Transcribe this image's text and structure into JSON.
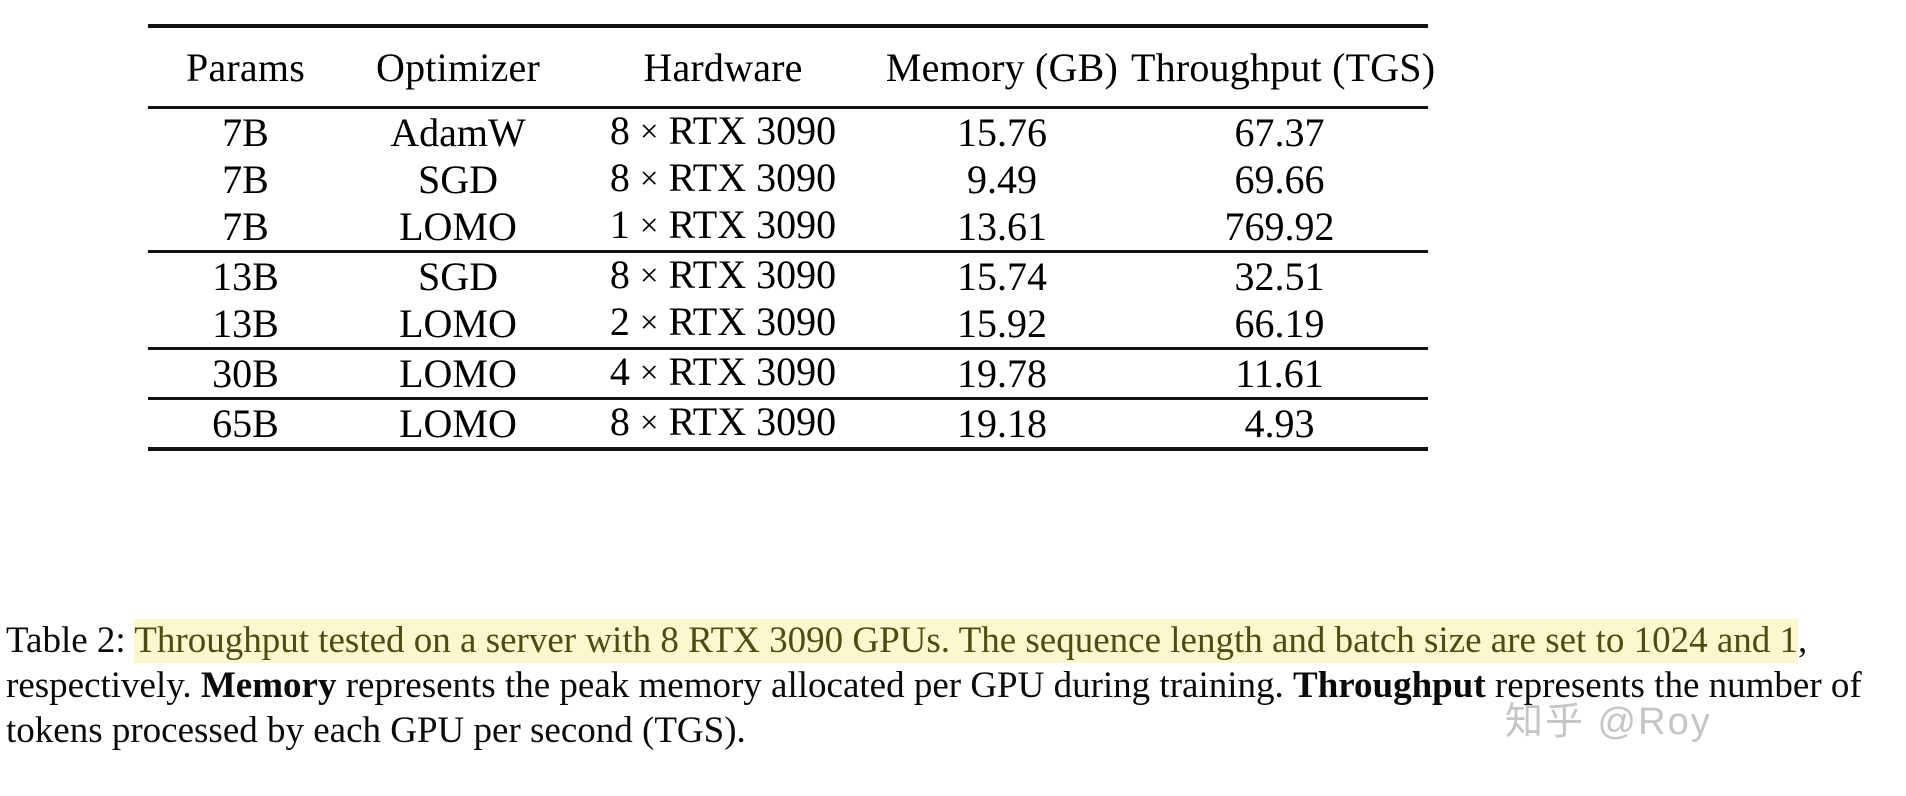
{
  "table": {
    "columns": [
      "Params",
      "Optimizer",
      "Hardware",
      "Memory (GB)",
      "Throughput (TGS)"
    ],
    "groups": [
      {
        "rows": [
          {
            "params": "7B",
            "optimizer": "AdamW",
            "hw_count": "8",
            "hw_times": "×",
            "hw_device": "RTX 3090",
            "memory": "15.76",
            "throughput": "67.37"
          },
          {
            "params": "7B",
            "optimizer": "SGD",
            "hw_count": "8",
            "hw_times": "×",
            "hw_device": "RTX 3090",
            "memory": "9.49",
            "throughput": "69.66"
          },
          {
            "params": "7B",
            "optimizer": "LOMO",
            "hw_count": "1",
            "hw_times": "×",
            "hw_device": "RTX 3090",
            "memory": "13.61",
            "throughput": "769.92"
          }
        ]
      },
      {
        "rows": [
          {
            "params": "13B",
            "optimizer": "SGD",
            "hw_count": "8",
            "hw_times": "×",
            "hw_device": "RTX 3090",
            "memory": "15.74",
            "throughput": "32.51"
          },
          {
            "params": "13B",
            "optimizer": "LOMO",
            "hw_count": "2",
            "hw_times": "×",
            "hw_device": "RTX 3090",
            "memory": "15.92",
            "throughput": "66.19"
          }
        ]
      },
      {
        "rows": [
          {
            "params": "30B",
            "optimizer": "LOMO",
            "hw_count": "4",
            "hw_times": "×",
            "hw_device": "RTX 3090",
            "memory": "19.78",
            "throughput": "11.61"
          }
        ]
      },
      {
        "rows": [
          {
            "params": "65B",
            "optimizer": "LOMO",
            "hw_count": "8",
            "hw_times": "×",
            "hw_device": "RTX 3090",
            "memory": "19.18",
            "throughput": "4.93"
          }
        ]
      }
    ]
  },
  "caption": {
    "label": "Table 2: ",
    "highlight_1": "Throughput tested on a server with 8 RTX 3090 GPUs. The sequence length and batch size are set to 1024 and 1",
    "rest_1": ", respectively. ",
    "bold_1": "Memory",
    "rest_2": " represents the peak memory allocated per GPU during training. ",
    "bold_2": "Throughput",
    "rest_3": " represents the number of tokens processed by each GPU per second (TGS)."
  },
  "watermark": {
    "text": "知乎 @Roy"
  }
}
